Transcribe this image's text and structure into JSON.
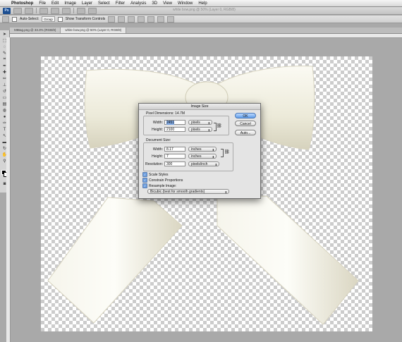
{
  "menubar": {
    "app_name": "Photoshop",
    "items": [
      "File",
      "Edit",
      "Image",
      "Layer",
      "Select",
      "Filter",
      "Analysis",
      "3D",
      "View",
      "Window",
      "Help"
    ]
  },
  "appbar": {
    "logo": "Ps",
    "title_dim": "white bow.png @ 50% (Layer 0, RGB/8)"
  },
  "options": {
    "auto_select_label": "Auto-Select:",
    "auto_select_value": "Group",
    "show_transform_label": "Show Transform Controls"
  },
  "tabs": [
    {
      "label": "MtBag.png @ 33.3% (RGB/8)"
    },
    {
      "label": "white bow.png @ 50% (Layer 0, RGB/8)"
    }
  ],
  "dialog": {
    "title": "Image Size",
    "pixel_dimensions_label": "Pixel Dimensions:",
    "pixel_dimensions_value": "14.7M",
    "px_width_label": "Width:",
    "px_width_value": "2451",
    "px_width_unit": "pixels",
    "px_height_label": "Height:",
    "px_height_value": "2100",
    "px_height_unit": "pixels",
    "document_size_label": "Document Size:",
    "doc_width_label": "Width:",
    "doc_width_value": "8.17",
    "doc_width_unit": "inches",
    "doc_height_label": "Height:",
    "doc_height_value": "7",
    "doc_height_unit": "inches",
    "resolution_label": "Resolution:",
    "resolution_value": "300",
    "resolution_unit": "pixels/inch",
    "scale_styles": "Scale Styles",
    "constrain": "Constrain Proportions",
    "resample": "Resample Image:",
    "resample_method": "Bicubic (best for smooth gradients)",
    "ok": "OK",
    "cancel": "Cancel",
    "auto": "Auto..."
  },
  "colors": {
    "foreground": "#000000",
    "background": "#ffffff",
    "ok_button": "#5f9ce8",
    "bow": "#f3f1e6"
  }
}
